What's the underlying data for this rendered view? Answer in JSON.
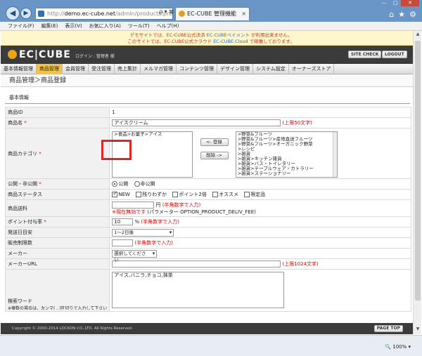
{
  "browser": {
    "back_icon": "back-arrow-icon",
    "forward_icon": "forward-arrow-icon",
    "address_prefix": "http://",
    "address_host": "demo.ec-cube.net",
    "address_path": "/admin/products/produc",
    "address_buttons": "ρ ▾ ⊠ C ✕",
    "tab_title": "EC-CUBE 管理機能",
    "tab_close": "×",
    "window_min": "—",
    "window_max": "□",
    "window_close": "✕",
    "toolbar_icons": [
      "home-icon",
      "star-icon",
      "gear-icon"
    ],
    "menu": [
      "ファイル(F)",
      "編集(E)",
      "表示(V)",
      "お気に入り(A)",
      "ツール(T)",
      "ヘルプ(H)"
    ],
    "zoom": "100%"
  },
  "notice": {
    "line1_a": "デモサイトでは、EC-CUBE公式決済 ",
    "line1_b": "EC-CUBEペイメント",
    "line1_c": " が利用出来ません。",
    "line2_a": "このサイトでは、EC-CUBE公式クラウド ",
    "line2_b": "EC-CUBE Cloud",
    "line2_c": " で稼働しております。"
  },
  "header": {
    "logo": "EC|CUBE",
    "login": "ログイン : 管理者 様",
    "sitecheck": "SITE CHECK",
    "logout": "LOGOUT"
  },
  "mainnav": [
    "基本情報管理",
    "商品管理",
    "会員管理",
    "受注管理",
    "売上集計",
    "メルマガ管理",
    "コンテンツ管理",
    "デザイン管理",
    "システム設定",
    "オーナーズストア"
  ],
  "active_nav_index": 1,
  "page_title": "商品管理＞商品登録",
  "section_title": "基本情報",
  "form": {
    "product_id_label": "商品ID",
    "product_id": "1",
    "name_label": "商品名",
    "name_value": "アイスクリーム",
    "name_limit": "(上限50文字)",
    "category_label": "商品カテゴリ",
    "category_selected": [
      ">食品>お菓子>アイス"
    ],
    "category_add": "<- 登録",
    "category_remove": "削除 ->",
    "category_all": [
      ">野菜&フルーツ",
      ">野菜&フルーツ>産地直送フルーツ",
      ">野菜&フルーツ>オーガニック野菜",
      ">レシピ",
      ">雑貨",
      ">雑貨>キッチン雑貨",
      ">雑貨>バス・トイレタリー",
      ">雑貨>テーブルウェア・カトラリー",
      ">雑貨>ステーショナリー"
    ],
    "public_label": "公開・非公開",
    "public_options": [
      "公開",
      "非公開"
    ],
    "status_label": "商品ステータス",
    "status_options": [
      "NEW",
      "残りわずか",
      "ポイント2倍",
      "オススメ",
      "限定品"
    ],
    "shipping_label": "商品送料",
    "shipping_unit": "円",
    "shipping_note": "(半角数字で入力)",
    "shipping_warn": "※現在無効です",
    "shipping_param": "(パラメーター OPTION_PRODUCT_DELIV_FEE)",
    "point_label": "ポイント付与率",
    "point_value": "10",
    "point_unit": "%",
    "point_note": "(半角数字で入力)",
    "delivery_label": "発送日目安",
    "delivery_value": "1〜2日後",
    "limit_label": "販売制限数",
    "limit_note": "(半角数字で入力)",
    "maker_label": "メーカー",
    "maker_value": "選択してください",
    "maker_url_label": "メーカーURL",
    "maker_url_limit": "(上限1024文字)",
    "search_word_label": "検索ワード",
    "search_word_sub": "※複数の場合は、カンマ( , )区切りで入力して下さい",
    "search_word_value": "アイス,バニラ,チョコ,抹茶"
  },
  "footer": {
    "copyright": "Copyright © 2000-2014 LOCKON CO.,LTD. All Rights Reserved.",
    "pagetop": "PAGE TOP"
  }
}
